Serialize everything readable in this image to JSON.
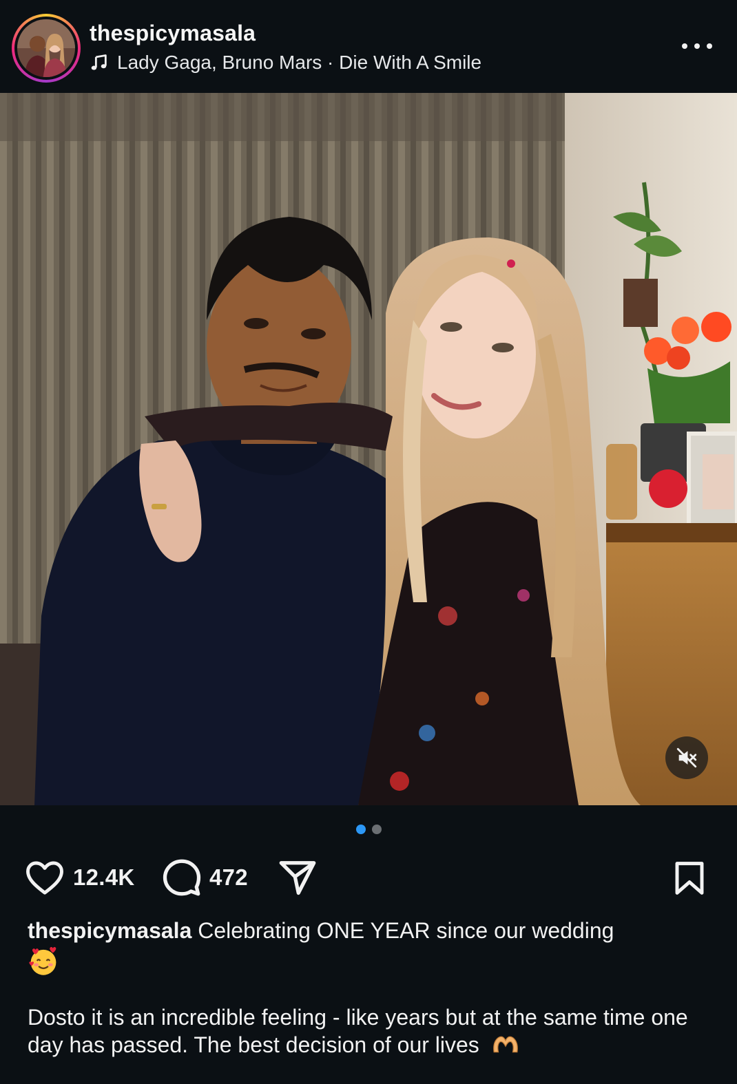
{
  "post": {
    "username": "thespicymasala",
    "music_label": "Lady Gaga, Bruno Mars · Die With A Smile",
    "media_alt": "Photo of a smiling couple sitting in front of a curtain",
    "carousel": {
      "count": 2,
      "active_index": 0
    }
  },
  "actions": {
    "likes": "12.4K",
    "comments": "472"
  },
  "caption": {
    "username": "thespicymasala",
    "text": "Celebrating ONE YEAR since our wedding",
    "emoji_1": "smiling-face-with-hearts",
    "body": "Dosto it is an incredible feeling - like years but at the same time one day has passed. The best decision of our lives",
    "emoji_2": "heart-hands"
  },
  "colors": {
    "background": "#0b1014",
    "text": "#f2f2f2",
    "active_dot": "#2c97f5",
    "inactive_dot": "#6b6f73"
  }
}
